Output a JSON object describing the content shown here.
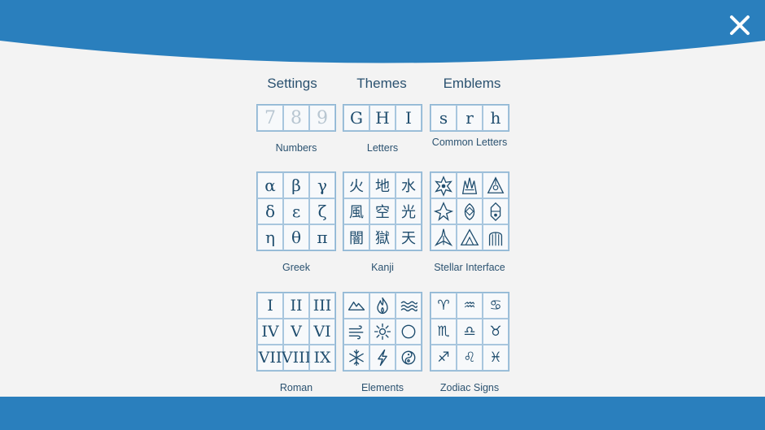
{
  "close_icon": "close-icon",
  "tabs": [
    {
      "label": "Settings"
    },
    {
      "label": "Themes"
    },
    {
      "label": "Emblems"
    }
  ],
  "themes": [
    {
      "caption": "Numbers",
      "cells": [
        "7",
        "8",
        "9"
      ],
      "dim": true
    },
    {
      "caption": "Letters",
      "cells": [
        "G",
        "H",
        "I"
      ]
    },
    {
      "caption": "Common Letters",
      "cells": [
        "s",
        "r",
        "h"
      ]
    },
    {
      "caption": "Greek",
      "cells": [
        "α",
        "β",
        "γ",
        "δ",
        "ε",
        "ζ",
        "η",
        "θ",
        "π"
      ]
    },
    {
      "caption": "Kanji",
      "cells": [
        "火",
        "地",
        "水",
        "風",
        "空",
        "光",
        "闇",
        "獄",
        "天"
      ]
    },
    {
      "caption": "Stellar Interface",
      "cells": [
        "glyph-1",
        "glyph-2",
        "glyph-3",
        "glyph-4",
        "glyph-5",
        "glyph-6",
        "glyph-7",
        "glyph-8",
        "glyph-9"
      ]
    },
    {
      "caption": "Roman",
      "cells": [
        "I",
        "II",
        "III",
        "IV",
        "V",
        "VI",
        "VII",
        "VIII",
        "IX"
      ]
    },
    {
      "caption": "Elements",
      "cells": [
        "mountain-icon",
        "fire-icon",
        "water-icon",
        "wind-icon",
        "sun-icon",
        "circle-icon",
        "snowflake-icon",
        "lightning-icon",
        "yin-yang-icon"
      ]
    },
    {
      "caption": "Zodiac Signs",
      "cells": [
        "♈",
        "♒",
        "♋",
        "♏",
        "♎",
        "♉",
        "♐",
        "♌",
        "♓"
      ]
    }
  ],
  "colors": {
    "accent": "#2a7fbd",
    "background": "#f3f3f3",
    "text": "#1f4d6e"
  }
}
